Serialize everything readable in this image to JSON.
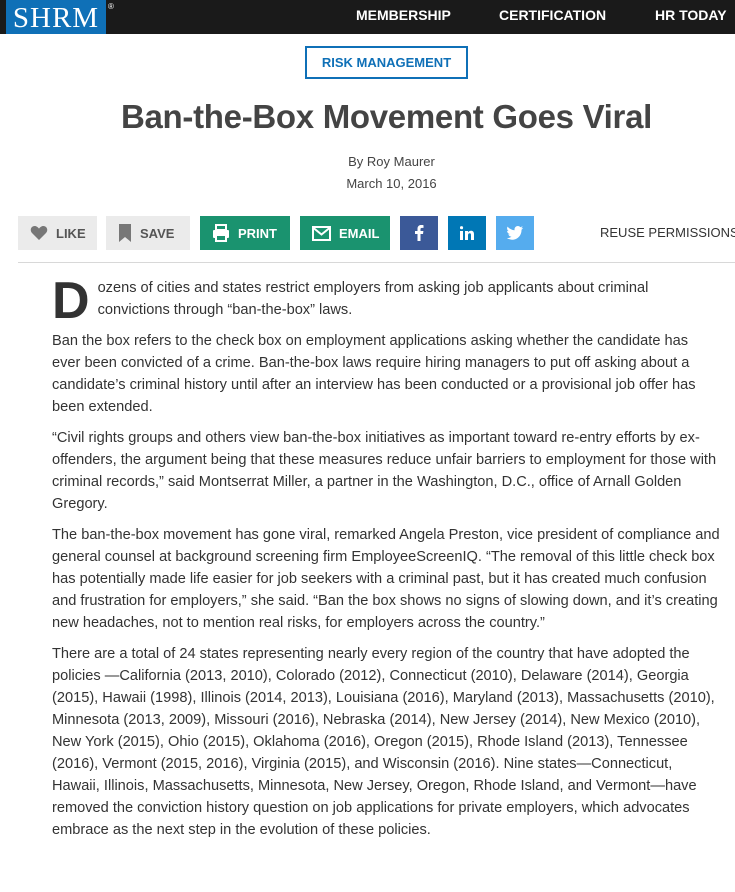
{
  "header": {
    "logo": "SHRM",
    "logo_mark": "®",
    "nav": [
      "MEMBERSHIP",
      "CERTIFICATION",
      "HR TODAY"
    ]
  },
  "article": {
    "category": "RISK MANAGEMENT",
    "title": "Ban-the-Box Movement Goes Viral",
    "byline": "By Roy Maurer",
    "date": "March 10, 2016",
    "dropcap": "D",
    "paragraphs": [
      "ozens of cities and states restrict employers from asking job applicants about criminal convictions through “ban-the-box” laws.",
      "Ban the box refers to the check box on employment applications asking whether the candidate has ever been convicted of a crime. Ban-the-box laws require hiring managers to put off asking about a candidate’s criminal history until after an interview has been conducted or a provisional job offer has been extended.",
      "“Civil rights groups and others view ban-the-box initiatives as important toward re-entry efforts by ex-offenders, the argument being that these measures reduce unfair barriers to employment for those with criminal records,” said Montserrat Miller, a partner in the Washington, D.C., office of Arnall Golden Gregory.",
      "The ban-the-box movement has gone viral, remarked Angela Preston, vice president of compliance and general counsel at background screening firm EmployeeScreenIQ. “The removal of this little check box has potentially made life easier for job seekers with a criminal past, but it has created much confusion and frustration for employers,” she said. “Ban the box shows no signs of slowing down, and it’s creating new headaches, not to mention real risks, for employers across the country.”",
      "There are a total of 24 states representing nearly every region of the country that have adopted the policies —California (2013, 2010), Colorado (2012), Connecticut (2010), Delaware (2014), Georgia (2015), Hawaii (1998), Illinois (2014, 2013), Louisiana (2016), Maryland (2013), Massachusetts (2010), Minnesota (2013, 2009), Missouri (2016), Nebraska (2014), New Jersey (2014), New Mexico (2010), New York (2015), Ohio (2015), Oklahoma (2016), Oregon (2015), Rhode Island (2013), Tennessee (2016), Vermont (2015, 2016), Virginia (2015), and Wisconsin (2016). Nine states—Connecticut, Hawaii, Illinois, Massachusetts, Minnesota, New Jersey, Oregon, Rhode Island, and Vermont—have removed the conviction history question on job applications for private employers, which advocates embrace as the next step in the evolution of these policies."
    ]
  },
  "share": {
    "like": "LIKE",
    "save": "SAVE",
    "print": "PRINT",
    "email": "EMAIL",
    "reuse": "REUSE PERMISSIONS",
    "icons": [
      "heart-icon",
      "bookmark-icon",
      "printer-icon",
      "envelope-icon",
      "facebook-icon",
      "linkedin-icon",
      "twitter-icon"
    ]
  },
  "colors": {
    "topbar": "#1a1a1a",
    "brand_blue": "#0f70b7",
    "share_green": "#1a936f",
    "facebook": "#3b5998",
    "linkedin": "#0077b5",
    "twitter": "#55acee"
  }
}
